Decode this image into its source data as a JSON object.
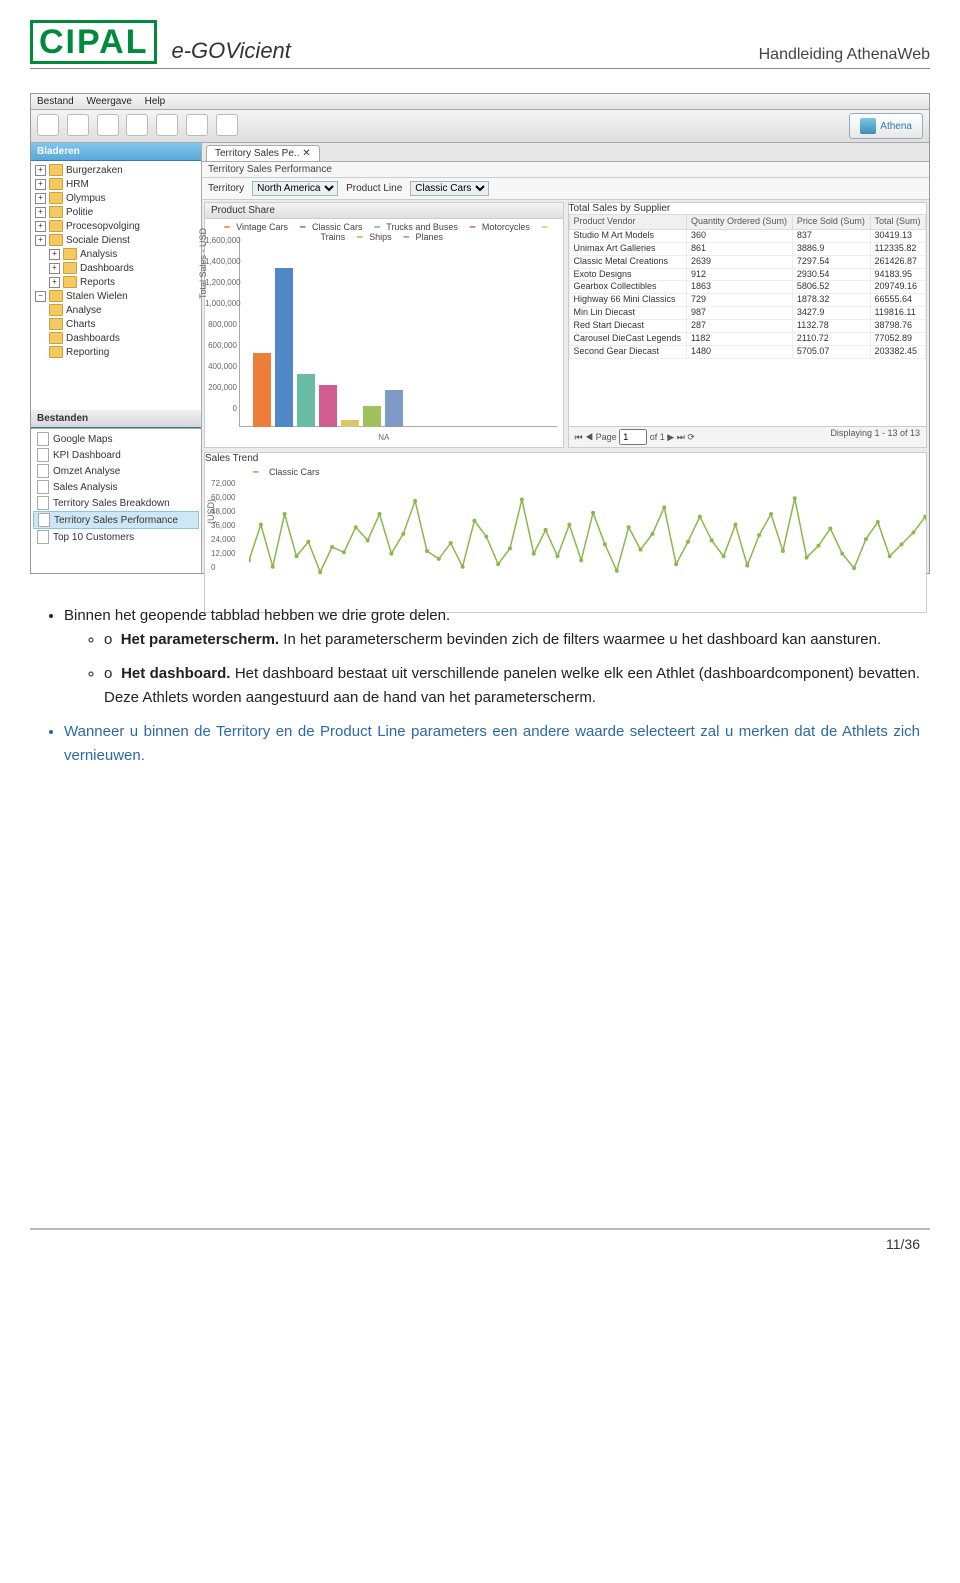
{
  "header": {
    "title": "Handleiding AthenaWeb",
    "logo1": "CIPAL",
    "logo2": "e-GOVicient"
  },
  "menubar": {
    "bestand": "Bestand",
    "weergave": "Weergave",
    "help": "Help"
  },
  "athena_button": "Athena",
  "sidebar": {
    "bladeren_title": "Bladeren",
    "items": [
      "Burgerzaken",
      "HRM",
      "Olympus",
      "Politie",
      "Procesopvolging",
      "Sociale Dienst"
    ],
    "sub_items": [
      "Analysis",
      "Dashboards",
      "Reports"
    ],
    "stalen_wielen": "Stalen Wielen",
    "sw_items": [
      "Analyse",
      "Charts",
      "Dashboards",
      "Reporting"
    ],
    "bestanden_title": "Bestanden",
    "bestanden": [
      "Google Maps",
      "KPI Dashboard",
      "Omzet Analyse",
      "Sales Analysis",
      "Territory Sales Breakdown",
      "Territory Sales Performance",
      "Top 10 Customers"
    ]
  },
  "tab": {
    "label": "Territory Sales Pe..",
    "crumb": "Territory Sales Performance"
  },
  "params": {
    "territory_label": "Territory",
    "territory_value": "North America",
    "productline_label": "Product Line",
    "productline_value": "Classic Cars"
  },
  "product_share": {
    "title": "Product Share",
    "legend": [
      "Vintage Cars",
      "Classic Cars",
      "Trucks and Buses",
      "Motorcycles",
      "Trains",
      "Ships",
      "Planes"
    ],
    "ylabel": "Total Sales - USD",
    "xlabel": "NA",
    "ticks": [
      "1,600,000",
      "1,400,000",
      "1,200,000",
      "1,000,000",
      "800,000",
      "600,000",
      "400,000",
      "200,000",
      "0"
    ]
  },
  "total_sales": {
    "title": "Total Sales by Supplier",
    "cols": [
      "Product Vendor",
      "Quantity Ordered (Sum)",
      "Price Sold (Sum)",
      "Total (Sum)"
    ],
    "rows": [
      [
        "Studio M Art Models",
        "360",
        "837",
        "30419.13"
      ],
      [
        "Unimax Art Galleries",
        "861",
        "3886.9",
        "112335.82"
      ],
      [
        "Classic Metal Creations",
        "2639",
        "7297.54",
        "261426.87"
      ],
      [
        "Exoto Designs",
        "912",
        "2930.54",
        "94183.95"
      ],
      [
        "Gearbox Collectibles",
        "1863",
        "5806.52",
        "209749.16"
      ],
      [
        "Highway 66 Mini Classics",
        "729",
        "1878.32",
        "66555.64"
      ],
      [
        "Min Lin Diecast",
        "987",
        "3427.9",
        "119816.11"
      ],
      [
        "Red Start Diecast",
        "287",
        "1132.78",
        "38798.76"
      ],
      [
        "Carousel DieCast Legends",
        "1182",
        "2110.72",
        "77052.89"
      ],
      [
        "Second Gear Diecast",
        "1480",
        "5705.07",
        "203382.45"
      ]
    ],
    "pager_page_label": "Page",
    "pager_page": "1",
    "pager_of": "of 1",
    "pager_display": "Displaying 1 - 13 of 13"
  },
  "sales_trend": {
    "title": "Sales Trend",
    "series_name": "Classic Cars",
    "ylabel": "(USD)",
    "ticks": [
      "72,000",
      "60,000",
      "48,000",
      "36,000",
      "24,000",
      "12,000",
      "0"
    ]
  },
  "chart_data": [
    {
      "type": "bar",
      "title": "Product Share",
      "xlabel": "NA",
      "ylabel": "Total Sales - USD",
      "ylim": [
        0,
        1600000
      ],
      "categories": [
        "Vintage Cars",
        "Classic Cars",
        "Trucks and Buses",
        "Motorcycles",
        "Trains",
        "Ships",
        "Planes"
      ],
      "values": [
        700000,
        1500000,
        500000,
        400000,
        70000,
        200000,
        350000
      ],
      "colors": [
        "#ef7d3a",
        "#4f87c7",
        "#68bca3",
        "#d15c8e",
        "#d7c96a",
        "#9fc25c",
        "#7e9bc8"
      ]
    },
    {
      "type": "line",
      "title": "Sales Trend",
      "ylabel": "(USD)",
      "ylim": [
        0,
        72000
      ],
      "series": [
        {
          "name": "Classic Cars",
          "values": [
            15000,
            42000,
            10000,
            50000,
            18000,
            29000,
            6000,
            25000,
            21000,
            40000,
            30000,
            50000,
            20000,
            35000,
            60000,
            22000,
            16000,
            28000,
            10000,
            45000,
            33000,
            12000,
            24000,
            61000,
            20000,
            38000,
            18000,
            42000,
            15000,
            51000,
            27000,
            7000,
            40000,
            23000,
            35000,
            55000,
            12000,
            29000,
            48000,
            30000,
            18000,
            42000,
            11000,
            34000,
            50000,
            22000,
            62000,
            17000,
            26000,
            39000,
            20000,
            9000,
            31000,
            44000,
            18000,
            27000,
            36000,
            48000,
            14000,
            30000
          ]
        }
      ]
    }
  ],
  "body": {
    "p1": "Binnen het geopende tabblad hebben we drie grote delen.",
    "s1_label": "Het parameterscherm.",
    "s1_text": " In het parameterscherm bevinden zich de filters waarmee u het dashboard kan aansturen.",
    "s2_label": "Het dashboard.",
    "s2_text": " Het dashboard bestaat uit verschillende panelen welke elk een Athlet (dashboardcomponent) bevatten. Deze Athlets worden aangestuurd aan de hand van het parameterscherm.",
    "p2": "Wanneer u binnen de Territory en de Product Line parameters een andere waarde selecteert zal u merken dat de Athlets zich vernieuwen."
  },
  "footer": {
    "pagenum": "11/36"
  }
}
